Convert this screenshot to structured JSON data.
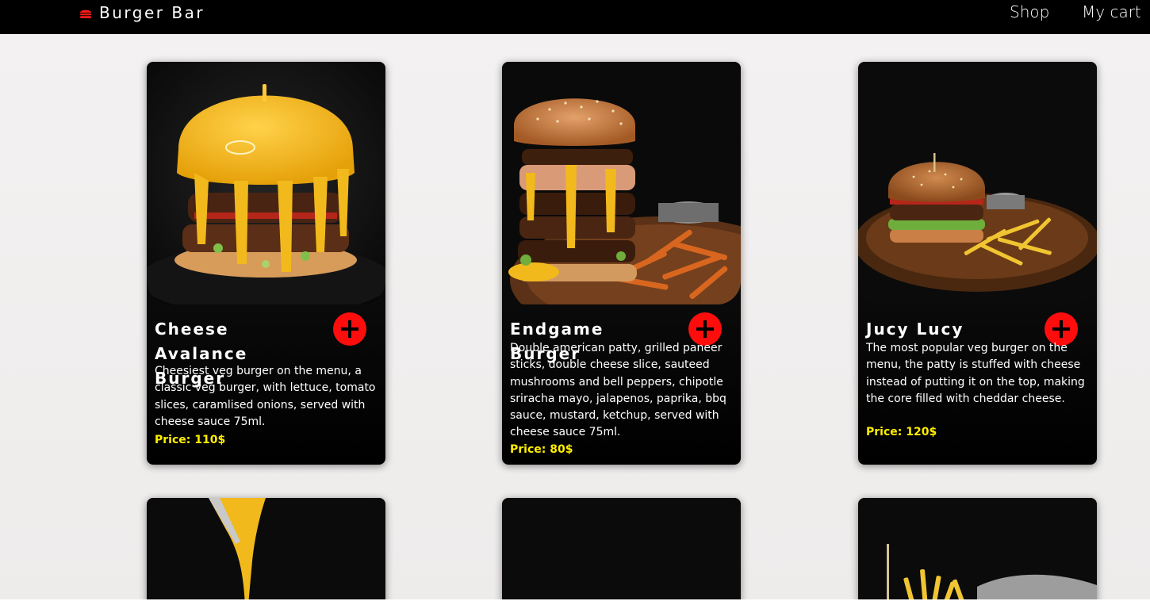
{
  "navbar": {
    "brand": "Burger Bar",
    "brand_icon": "burger-icon",
    "links": [
      "Shop",
      "My cart"
    ]
  },
  "colors": {
    "navbar_bg": "#000000",
    "accent_red": "#ff0d0d",
    "price_yellow": "#ffee00",
    "card_bg": "#0a0a0a",
    "page_bg": "#efeded"
  },
  "products": [
    {
      "title": "Cheese Avalance Burger",
      "description": "Cheesiest veg burger on the menu, a classic veg burger, with lettuce, tomato slices, caramlised onions, served with cheese sauce 75ml.",
      "price": "Price: 110$",
      "add_icon": "plus-icon"
    },
    {
      "title": "Endgame Burger",
      "description": "Double american patty, grilled paneer sticks, double cheese slice, sauteed mushrooms and bell peppers, chipotle sriracha mayo, jalapenos, paprika, bbq sauce, mustard, ketchup, served with cheese sauce 75ml.",
      "price": "Price: 80$",
      "add_icon": "plus-icon"
    },
    {
      "title": "Jucy Lucy",
      "description": "The most popular veg burger on the menu, the patty is stuffed with cheese instead of putting it on the top, making the core filled with cheddar cheese.",
      "price": "Price: 120$",
      "add_icon": "plus-icon"
    }
  ]
}
